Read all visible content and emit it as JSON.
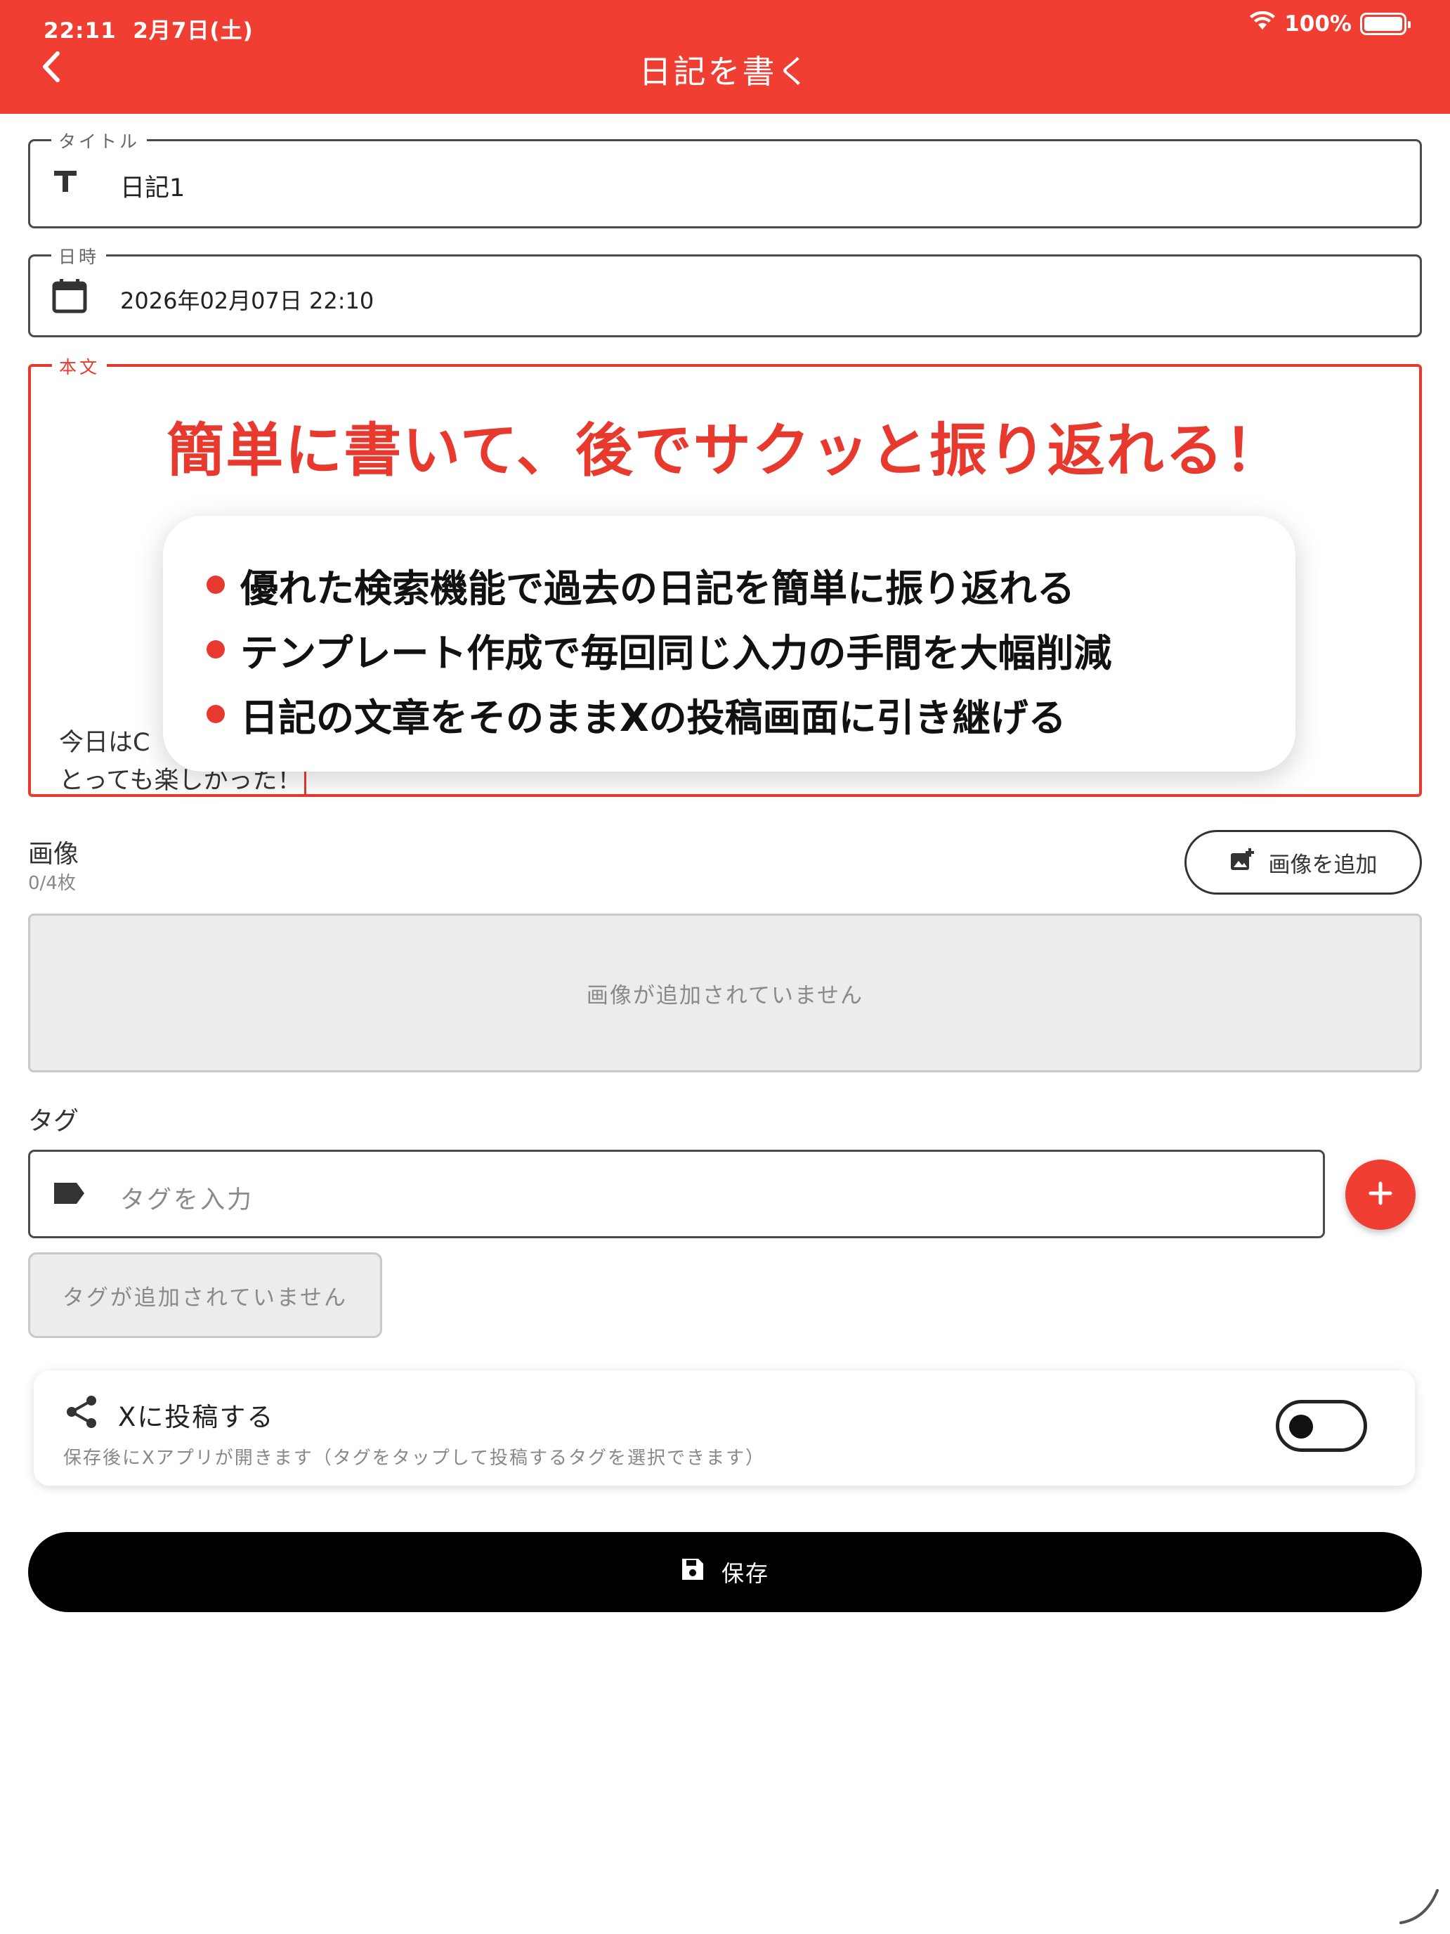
{
  "status_bar": {
    "time": "22:11",
    "date": "2月7日(土)",
    "battery": "100%",
    "battery_level": 1.0
  },
  "header": {
    "title": "日記を書く",
    "back_icon": "chevron-left-icon"
  },
  "form": {
    "title_field": {
      "label": "タイトル",
      "value": "日記1",
      "icon": "text-format-icon"
    },
    "date_field": {
      "label": "日時",
      "value": "2026年02月07日 22:10",
      "icon": "calendar-icon"
    },
    "body_field": {
      "label": "本文",
      "line1": "今日はC",
      "line2": "とっても楽しかった！"
    }
  },
  "promo": {
    "headline": "簡単に書いて、後でサクッと振り返れる！",
    "bullets": [
      "優れた検索機能で過去の日記を簡単に振り返れる",
      "テンプレート作成で毎回同じ入力の手間を大幅削減",
      "日記の文章をそのままXの投稿画面に引き継げる"
    ]
  },
  "images": {
    "label": "画像",
    "count": "0/4枚",
    "add_button": "画像を追加",
    "empty_text": "画像が追加されていません"
  },
  "tags": {
    "label": "タグ",
    "placeholder": "タグを入力",
    "empty_text": "タグが追加されていません"
  },
  "post_x": {
    "title": "Xに投稿する",
    "description": "保存後にXアプリが開きます（タグをタップして投稿するタグを選択できます）",
    "enabled": false
  },
  "save_button": {
    "label": "保存"
  },
  "colors": {
    "accent": "#f03e32",
    "border": "#4a4a4a",
    "muted_text": "#8a8a8a",
    "empty_bg": "#ececec"
  }
}
